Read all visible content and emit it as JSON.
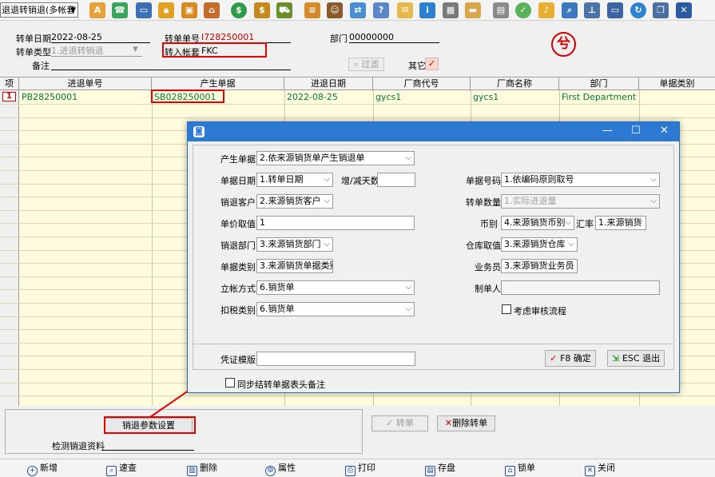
{
  "toolbar": {
    "mode_select": "退退转销退(多帐套",
    "icons": [
      "spell-check-icon",
      "phone-icon",
      "monitor-icon",
      "lock-icon",
      "briefcase-icon",
      "home-icon",
      "dollar-icon",
      "money-bag-icon",
      "cart-icon",
      "clipboard-icon",
      "people-icon",
      "exchange-icon",
      "help-icon",
      "mail-icon",
      "info-icon",
      "calculator-icon",
      "folder-icon",
      "document-icon",
      "check-circle-icon",
      "bell-icon",
      "search-icon",
      "org-chart-icon",
      "screen-icon",
      "refresh-icon",
      "window-icon",
      "close-icon"
    ]
  },
  "header": {
    "date_label": "转单日期",
    "date_value": "2022-08-25",
    "type_label": "转单类型",
    "type_value": "1.进退转销退",
    "remark_label": "备注",
    "remark_value": "",
    "order_no_label": "转单单号",
    "order_no_value": "I728250001",
    "account_label": "转入帐套",
    "account_value": "FKC",
    "dept_label": "部门",
    "dept_value": "00000000",
    "filter_label": "过滤",
    "other_label": "其它",
    "stamp": "兮"
  },
  "grid": {
    "columns": [
      "项",
      "进退单号",
      "产生单据",
      "进退日期",
      "厂商代号",
      "厂商名称",
      "部门",
      "单据类别"
    ],
    "rows": [
      {
        "index": "1",
        "cells": [
          "PB28250001",
          "SB028250001",
          "2022-08-25",
          "gycs1",
          "gycs1",
          "First Department",
          ""
        ]
      }
    ]
  },
  "bottom": {
    "settings_button": "销退参数设置",
    "check_label": "检测销退资料",
    "check_value": "",
    "convert_button": "转单",
    "delete_button": "删除转单"
  },
  "statusbar": {
    "add": "新增",
    "quick_search": "速查",
    "delete": "删除",
    "properties": "属性",
    "print": "打印",
    "save": "存盘",
    "lock": "锁单",
    "close": "关闭"
  },
  "dialog": {
    "title_controls": [
      "—",
      "☐",
      "✕"
    ],
    "source_doc_label": "产生单据",
    "source_doc_value": "2.依来源销货单产生销退单",
    "doc_date_label": "单据日期",
    "doc_date_value": "1.转单日期",
    "add_days_label": "增/减天数",
    "add_days_value": "",
    "doc_no_label": "单据号码",
    "doc_no_value": "1.依编码原则取号",
    "customer_label": "销退客户",
    "customer_value": "2.来源销货客户",
    "qty_label": "转单数量",
    "qty_value": "1.实际进退量",
    "price_label": "单价取值",
    "price_value": "1",
    "currency_label": "币别",
    "currency_value": "4.来源销货币别",
    "rate_label": "汇率",
    "rate_value": "1.来源销货",
    "dept_label": "销退部门",
    "dept_value": "3.来源销货部门",
    "warehouse_label": "仓库取值",
    "warehouse_value": "3.来源销货仓库",
    "doc_type_label": "单据类别",
    "doc_type_value": "3.来源销货单据类别",
    "salesman_label": "业务员",
    "salesman_value": "3.来源销货业务员",
    "account_method_label": "立帐方式",
    "account_method_value": "6.销货单",
    "maker_label": "制单人",
    "maker_value": "",
    "tax_type_label": "扣税类别",
    "tax_type_value": "6.销货单",
    "review_label": "考虑审核流程",
    "voucher_label": "凭证模版",
    "voucher_value": "",
    "ok_button": "F8 确定",
    "esc_button": "ESC 退出",
    "sync_label": "同步结转单据表头备注"
  }
}
